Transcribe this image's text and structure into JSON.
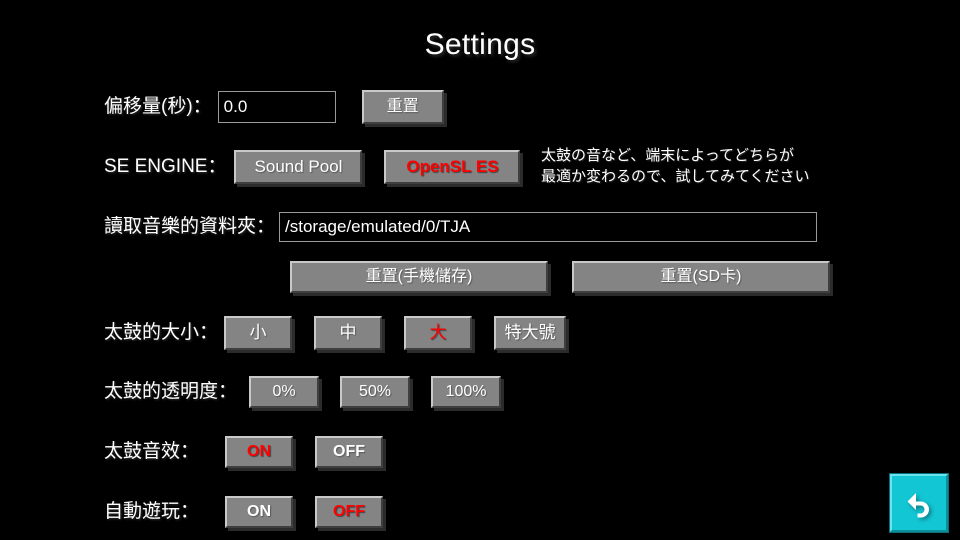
{
  "app": {
    "title": "Settings",
    "background_color": "#000000",
    "accent_selected_color": "#ff0000",
    "button_face_color": "#848484",
    "back_button_color": "#13c6d4"
  },
  "rows": {
    "offset": {
      "label": "偏移量(秒)：",
      "value": "0.0",
      "placeholder": "0.0",
      "reset_label": "重置"
    },
    "se_engine": {
      "label": "SE ENGINE：",
      "options": [
        {
          "label": "Sound Pool",
          "selected": false
        },
        {
          "label": "OpenSL ES",
          "selected": true
        }
      ],
      "hint_line1": "太鼓の音など、端末によってどちらが",
      "hint_line2": "最適か変わるので、試してみてください"
    },
    "music_folder": {
      "label": "讀取音樂的資料夾：",
      "value": "/storage/emulated/0/TJA",
      "placeholder": "/storage/emulated/0/TJA",
      "reset_internal_label": "重置(手機儲存)",
      "reset_sd_label": "重置(SD卡)"
    },
    "drum_size": {
      "label": "太鼓的大小：",
      "options": [
        {
          "label": "小",
          "selected": false
        },
        {
          "label": "中",
          "selected": false
        },
        {
          "label": "大",
          "selected": true
        },
        {
          "label": "特大號",
          "selected": false
        }
      ]
    },
    "drum_opacity": {
      "label": "太鼓的透明度：",
      "options": [
        {
          "label": "0%",
          "selected": false
        },
        {
          "label": "50%",
          "selected": true
        },
        {
          "label": "100%",
          "selected": false
        }
      ]
    },
    "drum_sound": {
      "label": "太鼓音效：",
      "options": [
        {
          "label": "ON",
          "selected": true
        },
        {
          "label": "OFF",
          "selected": false
        }
      ]
    },
    "auto_play": {
      "label": "自動遊玩：",
      "options": [
        {
          "label": "ON",
          "selected": false
        },
        {
          "label": "OFF",
          "selected": true
        }
      ]
    }
  },
  "back_button": {
    "icon": "back-arrow-icon"
  }
}
